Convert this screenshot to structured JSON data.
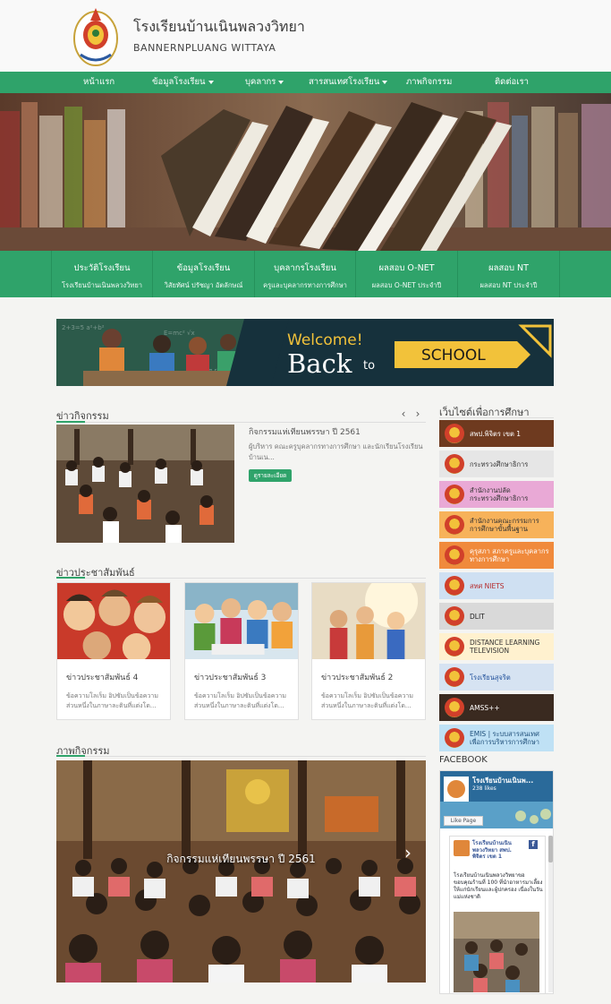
{
  "site": {
    "title": "โรงเรียนบ้านเนินพลวงวิทยา",
    "subtitle": "BANNERNPLUANG WITTAYA"
  },
  "nav": [
    {
      "label": "หน้าแรก",
      "dropdown": false
    },
    {
      "label": "ข้อมูลโรงเรียน",
      "dropdown": true
    },
    {
      "label": "บุคลากร",
      "dropdown": true
    },
    {
      "label": "สารสนเทศโรงเรียน",
      "dropdown": true
    },
    {
      "label": "ภาพกิจกรรม",
      "dropdown": false
    },
    {
      "label": "ติดต่อเรา",
      "dropdown": false
    }
  ],
  "quickbar": [
    {
      "title": "ประวัติโรงเรียน",
      "sub": "โรงเรียนบ้านเนินพลวงวิทยา"
    },
    {
      "title": "ข้อมูลโรงเรียน",
      "sub": "วิสัยทัศน์ ปรัชญา อัตลักษณ์"
    },
    {
      "title": "บุคลากรโรงเรียน",
      "sub": "ครูและบุคลากรทางการศึกษา"
    },
    {
      "title": "ผลสอบ O-NET",
      "sub": "ผลสอบ O-NET ประจำปี"
    },
    {
      "title": "ผลสอบ NT",
      "sub": "ผลสอบ NT ประจำปี"
    }
  ],
  "welcome": {
    "line1": "Welcome!",
    "line2": "Back",
    "line3": "to",
    "line4": "SCHOOL"
  },
  "activity": {
    "heading": "ข่าวกิจกรรม",
    "title": "กิจกรรมแห่เทียนพรรษา ปี 2561",
    "excerpt": "ผู้บริหาร คณะครูบุคลากรทางการศึกษา และนักเรียนโรงเรียนบ้านเน...",
    "button": "ดูรายละเอียด",
    "prev": "‹",
    "next": "›"
  },
  "pr": {
    "heading": "ข่าวประชาสัมพันธ์",
    "cards": [
      {
        "title": "ข่าวประชาสัมพันธ์ 4",
        "text": "ข้อความโลเร็ม อิปซัมเป็นข้อความส่วนหนึ่งในภาษาละตินที่แต่งโด..."
      },
      {
        "title": "ข่าวประชาสัมพันธ์ 3",
        "text": "ข้อความโลเร็ม อิปซัมเป็นข้อความส่วนหนึ่งในภาษาละตินที่แต่งโด..."
      },
      {
        "title": "ข่าวประชาสัมพันธ์ 2",
        "text": "ข้อความโลเร็ม อิปซัมเป็นข้อความส่วนหนึ่งในภาษาละตินที่แต่งโด..."
      }
    ]
  },
  "gallery": {
    "heading": "ภาพกิจกรรม",
    "caption": "กิจกรรมแห่เทียนพรรษา ปี 2561",
    "next": "›"
  },
  "sidebar": {
    "heading": "เว็บไซต์เพื่อการศึกษา",
    "links": [
      {
        "label": "สพป.พิจิตร เขต 1",
        "bg": "#6e3a1f",
        "fg": "#ffffff"
      },
      {
        "label": "กระทรวงศึกษาธิการ",
        "bg": "#e6e6e6",
        "fg": "#333333"
      },
      {
        "label": "สำนักงานปลัด\nกระทรวงศึกษาธิการ",
        "bg": "#e9a9d6",
        "fg": "#333333"
      },
      {
        "label": "สำนักงานคณะกรรมการ\nการศึกษาขั้นพื้นฐาน",
        "bg": "#f7b25a",
        "fg": "#333333"
      },
      {
        "label": "คุรุสภา สภาครูและบุคลากร\nทางการศึกษา",
        "bg": "#f08a3c",
        "fg": "#ffffff"
      },
      {
        "label": "สทศ NIETS",
        "bg": "#cfe0f2",
        "fg": "#b52a2a"
      },
      {
        "label": "DLIT",
        "bg": "#d9d9d9",
        "fg": "#222222"
      },
      {
        "label": "DISTANCE LEARNING\nTELEVISION",
        "bg": "#fff1cf",
        "fg": "#333333"
      },
      {
        "label": "โรงเรียนสุจริต",
        "bg": "#d6e3f2",
        "fg": "#1f4f9a"
      },
      {
        "label": "AMSS++",
        "bg": "#3a2a20",
        "fg": "#ffffff"
      },
      {
        "label": "EMIS | ระบบสารสนเทศ\nเพื่อการบริหารการศึกษา",
        "bg": "#bfe1f5",
        "fg": "#1f4f7a"
      }
    ],
    "facebook": {
      "heading": "FACEBOOK",
      "page_name": "โรงเรียนบ้านเนินพ...",
      "likes": "238 likes",
      "like_button": "Like Page",
      "post_name": "โรงเรียนบ้านเนิน\nพลวงวิทยา สพป.\nพิจิตร เขต 1",
      "post_text": "โรงเรียนบ้านเนินพลวงวิทยาขอขอบคุณร้านที่ 100 ที่นำอาหารมาเลี้ยงให้แก่นักเรียนและผู้ปกครอง เนื่องในวันแม่แห่งชาติ"
    }
  },
  "colors": {
    "accent": "#2fa36a",
    "nav_text": "#ffffff"
  }
}
